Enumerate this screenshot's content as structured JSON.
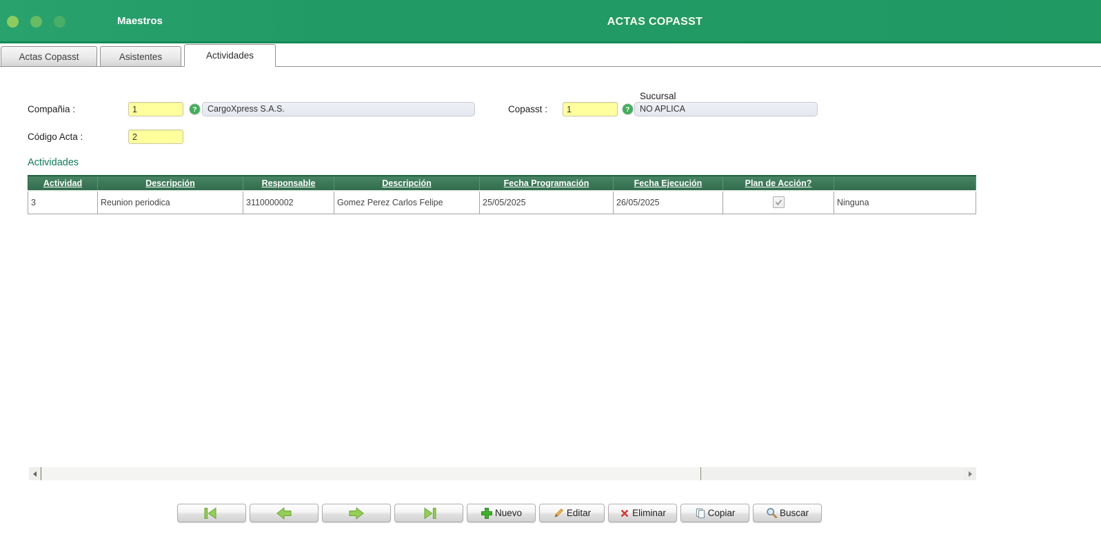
{
  "titlebar": {
    "app_title": "Maestros",
    "page_title": "ACTAS COPASST"
  },
  "tabs": [
    {
      "label": "Actas Copasst",
      "active": false
    },
    {
      "label": "Asistentes",
      "active": false
    },
    {
      "label": "Actividades",
      "active": true
    }
  ],
  "form": {
    "compania": {
      "label": "Compañia :",
      "code": "1",
      "name": "CargoXpress S.A.S."
    },
    "copasst": {
      "label": "Copasst :",
      "code": "1",
      "name": "NO APLICA"
    },
    "sucursal_label": "Sucursal",
    "codigo_acta": {
      "label": "Código Acta :",
      "value": "2"
    }
  },
  "grid": {
    "section_title": "Actividades",
    "columns": [
      "Actividad",
      "Descripción",
      "Responsable",
      "Descripción",
      "Fecha Programación",
      "Fecha Ejecución",
      "Plan de Acción?",
      ""
    ],
    "rows": [
      {
        "actividad": "3",
        "descripcion": "Reunion periodica",
        "responsable": "3110000002",
        "responsable_nombre": "Gomez Perez Carlos Felipe",
        "fecha_programacion": "25/05/2025",
        "fecha_ejecucion": "26/05/2025",
        "plan_de_accion_checked": "true",
        "plan_detalle": "Ninguna"
      }
    ]
  },
  "toolbar": {
    "nav": {
      "first": "first-record",
      "previous": "previous-record",
      "next": "next-record",
      "last": "last-record"
    },
    "buttons": [
      {
        "label": "Nuevo",
        "icon": "plus-icon"
      },
      {
        "label": "Editar",
        "icon": "pencil-icon"
      },
      {
        "label": "Eliminar",
        "icon": "delete-x-icon"
      },
      {
        "label": "Copiar",
        "icon": "copy-icon"
      },
      {
        "label": "Buscar",
        "icon": "search-icon"
      }
    ]
  },
  "colors": {
    "header_green": "#229a66",
    "header_border_green": "#128a53",
    "table_header_green": "#3a7d5a",
    "highlight_yellow": "#ffff9e",
    "section_title_teal": "#0c7b57"
  }
}
